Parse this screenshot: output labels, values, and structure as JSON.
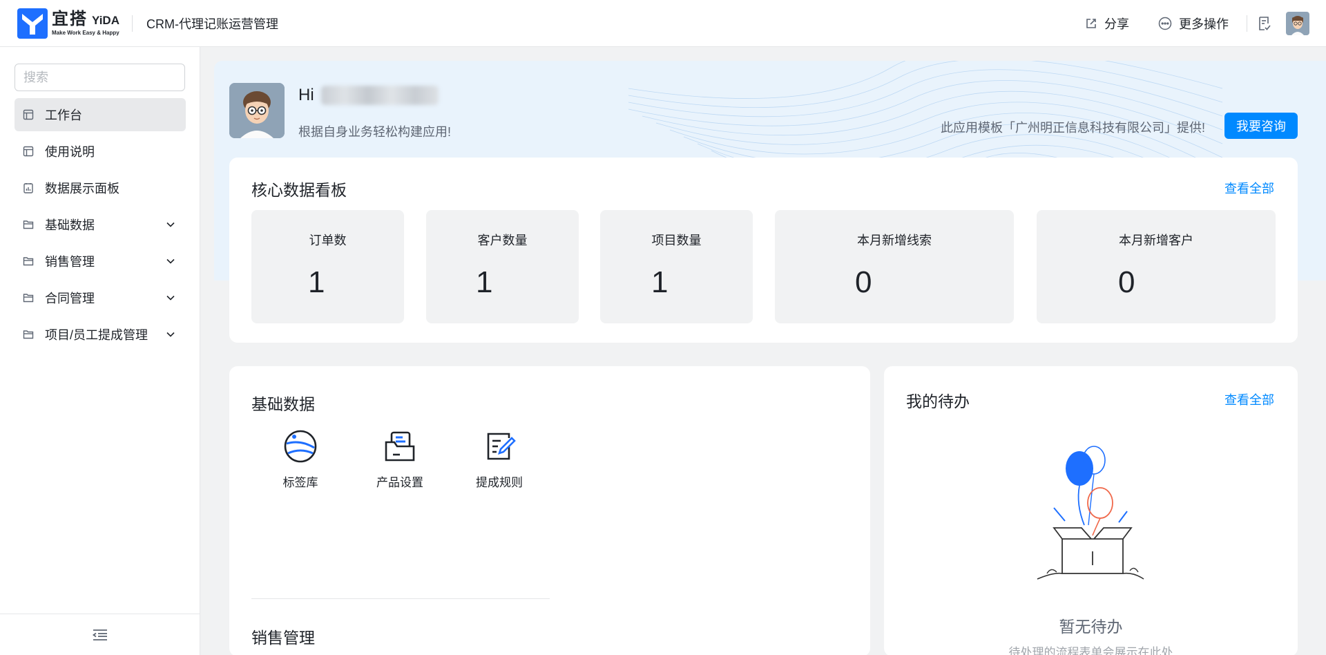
{
  "brand": {
    "name_cn": "宜搭",
    "name_en": "YiDA",
    "slogan": "Make Work Easy & Happy",
    "color": "#1e6fff"
  },
  "header": {
    "app_title": "CRM-代理记账运营管理",
    "share_label": "分享",
    "more_label": "更多操作"
  },
  "sidebar": {
    "search_placeholder": "搜索",
    "items": [
      {
        "label": "工作台",
        "icon": "page-icon",
        "active": true,
        "expandable": false
      },
      {
        "label": "使用说明",
        "icon": "page-icon",
        "active": false,
        "expandable": false
      },
      {
        "label": "数据展示面板",
        "icon": "dashboard-icon",
        "active": false,
        "expandable": false
      },
      {
        "label": "基础数据",
        "icon": "folder-icon",
        "active": false,
        "expandable": true
      },
      {
        "label": "销售管理",
        "icon": "folder-icon",
        "active": false,
        "expandable": true
      },
      {
        "label": "合同管理",
        "icon": "folder-icon",
        "active": false,
        "expandable": true
      },
      {
        "label": "项目/员工提成管理",
        "icon": "folder-icon",
        "active": false,
        "expandable": true
      }
    ]
  },
  "hero": {
    "greeting_prefix": "Hi",
    "subtitle": "根据自身业务轻松构建应用!",
    "template_note": "此应用模板「广州明正信息科技有限公司」提供!",
    "consult_button": "我要咨询"
  },
  "kpi_board": {
    "title": "核心数据看板",
    "view_all": "查看全部",
    "items": [
      {
        "label": "订单数",
        "value": "1"
      },
      {
        "label": "客户数量",
        "value": "1"
      },
      {
        "label": "项目数量",
        "value": "1"
      },
      {
        "label": "本月新增线索",
        "value": "0"
      },
      {
        "label": "本月新增客户",
        "value": "0"
      }
    ]
  },
  "base_data": {
    "title": "基础数据",
    "tools": [
      {
        "label": "标签库",
        "icon": "tag-library-icon"
      },
      {
        "label": "产品设置",
        "icon": "product-settings-icon"
      },
      {
        "label": "提成规则",
        "icon": "commission-rules-icon"
      }
    ],
    "next_section_title": "销售管理"
  },
  "todo": {
    "title": "我的待办",
    "view_all": "查看全部",
    "empty_title": "暂无待办",
    "empty_subtitle": "待处理的流程表单会展示在此处"
  },
  "colors": {
    "accent": "#0089ff",
    "hero_bg": "#e9f3fc",
    "page_bg": "#f1f2f3"
  }
}
